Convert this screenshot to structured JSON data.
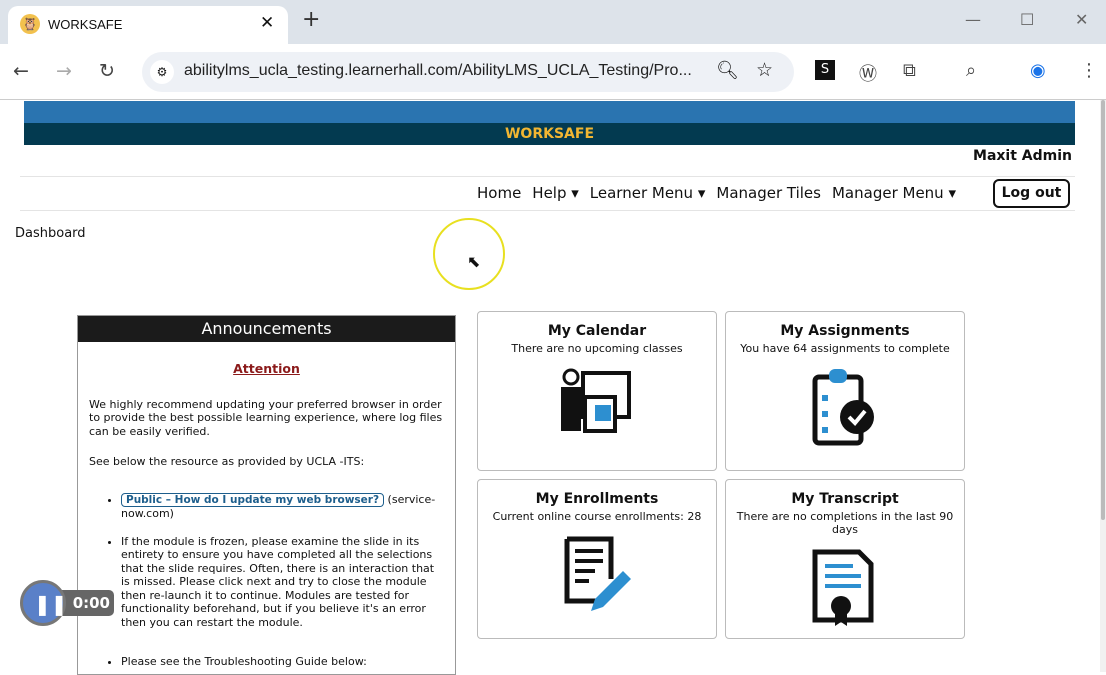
{
  "browser": {
    "tab_title": "WORKSAFE",
    "url": "abilitylms_ucla_testing.learnerhall.com/AbilityLMS_UCLA_Testing/Pro..."
  },
  "header": {
    "brand": "WORKSAFE",
    "user": "Maxit Admin"
  },
  "nav": {
    "items": [
      "Home",
      "Help ▾",
      "Learner Menu ▾",
      "Manager Tiles",
      "Manager Menu ▾"
    ],
    "logout": "Log out"
  },
  "breadcrumb": "Dashboard",
  "announcements": {
    "title": "Announcements",
    "attention": "Attention",
    "p1": "We highly recommend updating your preferred browser in order to provide the best possible learning experience, where log files can be easily verified.",
    "p2": "See below the resource as provided by UCLA -ITS:",
    "link": "Public – How do I update my web browser?",
    "link_suffix": " (service-now.com)",
    "bullet2": "If the module is frozen, please examine the slide in its entirety to ensure you have completed all the selections that the slide requires. Often, there is an interaction that is missed. Please click next and try to close the module then re-launch it to continue. Modules are tested for functionality beforehand, but if you believe it's an error then you can restart the module.",
    "bullet3": "Please see the Troubleshooting Guide below:"
  },
  "tiles": [
    {
      "title": "My Calendar",
      "subtitle": "There are no upcoming classes"
    },
    {
      "title": "My Assignments",
      "subtitle": "You have 64 assignments to complete"
    },
    {
      "title": "My Enrollments",
      "subtitle": "Current online course enrollments: 28"
    },
    {
      "title": "My Transcript",
      "subtitle": "There are no completions in the last 90 days"
    }
  ],
  "recorder": {
    "time": "0:00"
  },
  "colors": {
    "accent": "#2a74b0",
    "dark": "#033a50",
    "brand": "#f2b632"
  }
}
